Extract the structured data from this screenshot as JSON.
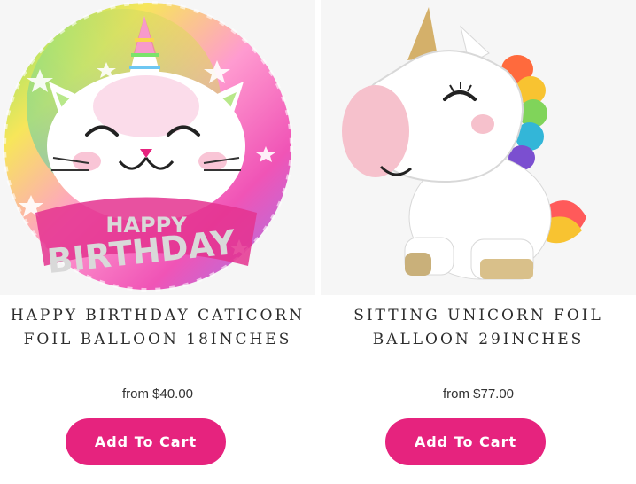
{
  "products": [
    {
      "title_line1": "HAPPY BIRTHDAY CATICORN",
      "title_line2": "FOIL BALLOON 18INCHES",
      "price": "from $40.00",
      "button_label": "Add To Cart",
      "image_text_line1": "HAPPY",
      "image_text_line2": "BIRTHDAY"
    },
    {
      "title_line1": "SITTING UNICORN FOIL",
      "title_line2": "BALLOON 29INCHES",
      "price": "from $77.00",
      "button_label": "Add To Cart"
    }
  ],
  "colors": {
    "button": "#e6237e",
    "title": "#2d2d2d",
    "image_bg": "#f6f6f6"
  }
}
